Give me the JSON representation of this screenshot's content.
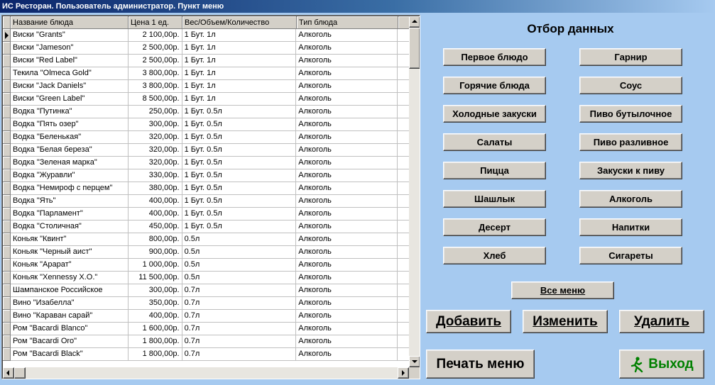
{
  "window": {
    "title": "ИС Ресторан. Пользователь администратор. Пункт меню"
  },
  "grid": {
    "columns": [
      "Название блюда",
      "Цена 1 ед.",
      "Вес/Объем/Количество",
      "Тип блюда"
    ],
    "current_row": 0,
    "rows": [
      [
        "Виски \"Grants\"",
        "2 100,00р.",
        "1 Бут. 1л",
        "Алкоголь"
      ],
      [
        "Виски \"Jameson\"",
        "2 500,00р.",
        "1 Бут. 1л",
        "Алкоголь"
      ],
      [
        "Виски \"Red Label\"",
        "2 500,00р.",
        "1 Бут. 1л",
        "Алкоголь"
      ],
      [
        "Текила \"Olmeca Gold\"",
        "3 800,00р.",
        "1 Бут. 1л",
        "Алкоголь"
      ],
      [
        "Виски \"Jack Daniels\"",
        "3 800,00р.",
        "1 Бут. 1л",
        "Алкоголь"
      ],
      [
        "Виски \"Green Label\"",
        "8 500,00р.",
        "1 Бут. 1л",
        "Алкоголь"
      ],
      [
        "Водка \"Путинка\"",
        "250,00р.",
        "1 Бут. 0.5л",
        "Алкоголь"
      ],
      [
        "Водка \"Пять озер\"",
        "300,00р.",
        "1 Бут. 0.5л",
        "Алкоголь"
      ],
      [
        "Водка \"Беленькая\"",
        "320,00р.",
        "1 Бут. 0.5л",
        "Алкоголь"
      ],
      [
        "Водка \"Белая береза\"",
        "320,00р.",
        "1 Бут. 0.5л",
        "Алкоголь"
      ],
      [
        "Водка \"Зеленая марка\"",
        "320,00р.",
        "1 Бут. 0.5л",
        "Алкоголь"
      ],
      [
        "Водка \"Журавли\"",
        "330,00р.",
        "1 Бут. 0.5л",
        "Алкоголь"
      ],
      [
        "Водка \"Немироф с перцем\"",
        "380,00р.",
        "1 Бут. 0.5л",
        "Алкоголь"
      ],
      [
        "Водка \"Ять\"",
        "400,00р.",
        "1 Бут. 0.5л",
        "Алкоголь"
      ],
      [
        "Водка \"Парламент\"",
        "400,00р.",
        "1 Бут. 0.5л",
        "Алкоголь"
      ],
      [
        "Водка \"Столичная\"",
        "450,00р.",
        "1 Бут. 0.5л",
        "Алкоголь"
      ],
      [
        "Коньяк \"Квинт\"",
        "800,00р.",
        "0.5л",
        "Алкоголь"
      ],
      [
        "Коньяк \"Черный аист\"",
        "900,00р.",
        "0.5л",
        "Алкоголь"
      ],
      [
        "Коньяк \"Арарат\"",
        "1 000,00р.",
        "0.5л",
        "Алкоголь"
      ],
      [
        "Коньяк \"Xennessy X.O.\"",
        "11 500,00р.",
        "0.5л",
        "Алкоголь"
      ],
      [
        "Шампанское Российское",
        "300,00р.",
        "0.7л",
        "Алкоголь"
      ],
      [
        "Вино \"Изабелла\"",
        "350,00р.",
        "0.7л",
        "Алкоголь"
      ],
      [
        "Вино \"Караван сарай\"",
        "400,00р.",
        "0.7л",
        "Алкоголь"
      ],
      [
        "Ром \"Bacardi Blanco\"",
        "1 600,00р.",
        "0.7л",
        "Алкоголь"
      ],
      [
        "Ром \"Bacardi Oro\"",
        "1 800,00р.",
        "0.7л",
        "Алкоголь"
      ],
      [
        "Ром \"Bacardi Black\"",
        "1 800,00р.",
        "0.7л",
        "Алкоголь"
      ]
    ]
  },
  "filter_panel": {
    "title": "Отбор данных",
    "buttons": [
      "Первое блюдо",
      "Гарнир",
      "Горячие блюда",
      "Соус",
      "Холодные закуски",
      "Пиво бутылочное",
      "Салаты",
      "Пиво разливное",
      "Пицца",
      "Закуски к пиву",
      "Шашлык",
      "Алкоголь",
      "Десерт",
      "Напитки",
      "Хлеб",
      "Сигареты"
    ],
    "all_menu": "Все меню"
  },
  "actions": {
    "add": "Добавить",
    "edit": "Изменить",
    "delete": "Удалить",
    "print": "Печать меню",
    "exit": "Выход"
  }
}
